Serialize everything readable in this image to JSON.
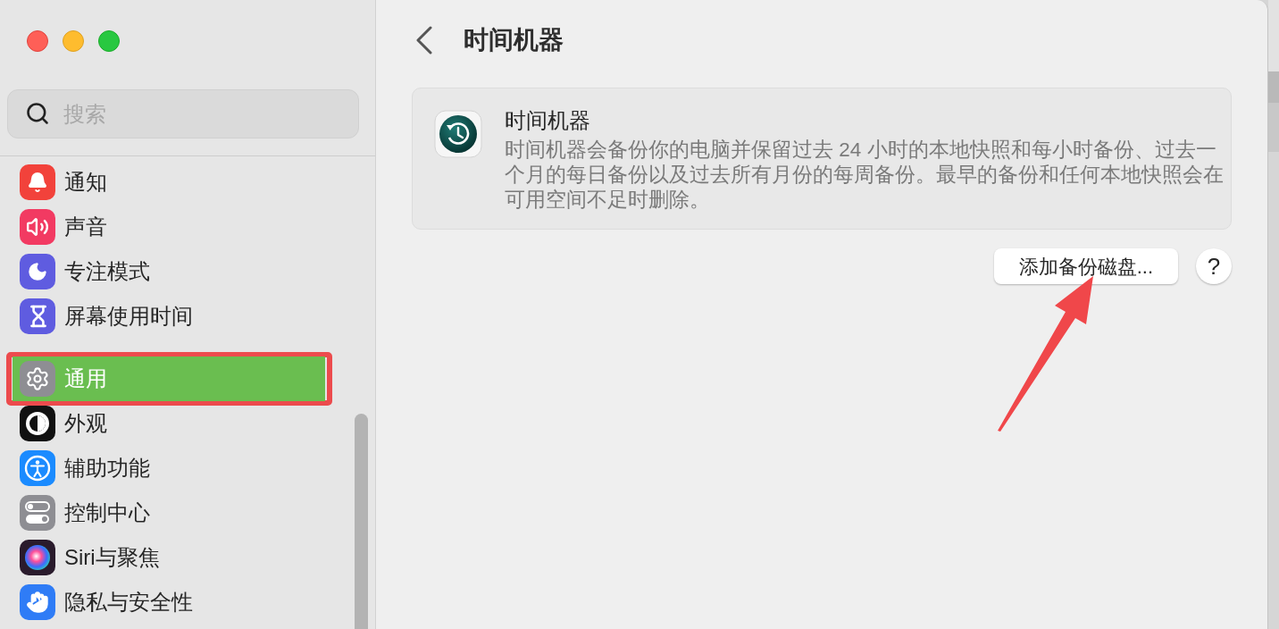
{
  "sidebar": {
    "search": {
      "placeholder": "搜索"
    },
    "groups": [
      {
        "items": [
          {
            "label": "通知",
            "selected": false
          },
          {
            "label": "声音",
            "selected": false
          },
          {
            "label": "专注模式",
            "selected": false
          },
          {
            "label": "屏幕使用时间",
            "selected": false
          }
        ]
      },
      {
        "items": [
          {
            "label": "通用",
            "selected": true
          },
          {
            "label": "外观",
            "selected": false
          },
          {
            "label": "辅助功能",
            "selected": false
          },
          {
            "label": "控制中心",
            "selected": false
          },
          {
            "label": "Siri与聚焦",
            "selected": false
          },
          {
            "label": "隐私与安全性",
            "selected": false
          }
        ]
      }
    ]
  },
  "main": {
    "title": "时间机器",
    "card": {
      "title": "时间机器",
      "description": "时间机器会备份你的电脑并保留过去 24 小时的本地快照和每小时备份、过去一个月的每日备份以及过去所有月份的每周备份。最早的备份和任何本地快照会在可用空间不足时删除。"
    },
    "add_disk_button": "添加备份磁盘...",
    "help_button": "?"
  }
}
